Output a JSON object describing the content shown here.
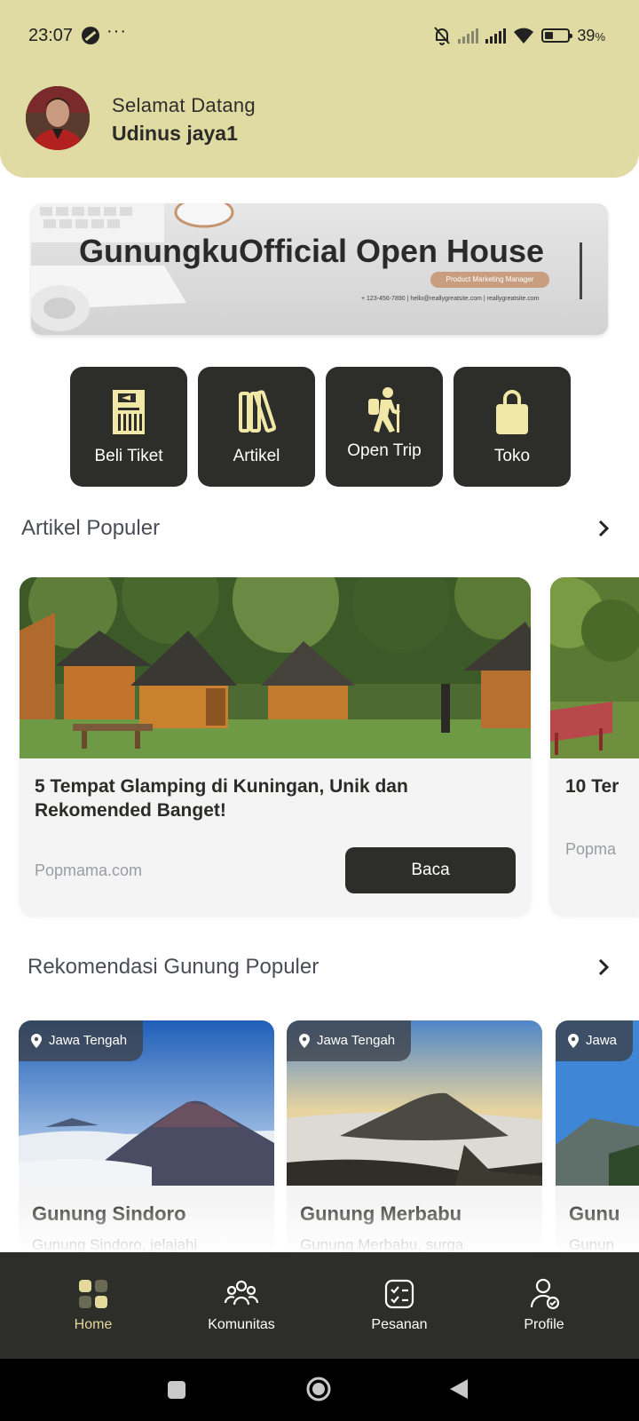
{
  "status_bar": {
    "time": "23:07",
    "dots": "···",
    "battery": "39",
    "battery_unit": "%",
    "battery_level": 0.39
  },
  "header": {
    "greeting": "Selamat Datang",
    "username": "Udinus jaya1"
  },
  "banner": {
    "title": "GunungkuOfficial Open House",
    "pill": "Product Marketing Manager",
    "contact": "+ 123-456-7890  |  hello@reallygreatsite.com  |  reallygreatsite.com"
  },
  "menu": [
    {
      "label": "Beli Tiket",
      "icon": "ticket-icon"
    },
    {
      "label": "Artikel",
      "icon": "books-icon"
    },
    {
      "label": "Open Trip",
      "icon": "hiker-icon"
    },
    {
      "label": "Toko",
      "icon": "shopping-bag-icon"
    }
  ],
  "articles": {
    "title": "Artikel Populer",
    "items": [
      {
        "title": "5 Tempat Glamping di Kuningan, Unik dan Rekomended Banget!",
        "source": "Popmama.com",
        "button": "Baca"
      },
      {
        "title": "10 Ter",
        "source": "Popma"
      }
    ]
  },
  "mountains": {
    "title": "Rekomendasi Gunung Populer",
    "items": [
      {
        "region": "Jawa Tengah",
        "name": "Gunung Sindoro",
        "desc": "Gunung Sindoro, jelajahi"
      },
      {
        "region": "Jawa Tengah",
        "name": "Gunung Merbabu",
        "desc": "Gunung Merbabu, surga"
      },
      {
        "region": "Jawa",
        "name": "Gunu",
        "desc": "Gunun"
      }
    ]
  },
  "bottom_nav": [
    {
      "label": "Home",
      "icon": "grid-icon",
      "active": true
    },
    {
      "label": "Komunitas",
      "icon": "community-icon",
      "active": false
    },
    {
      "label": "Pesanan",
      "icon": "orders-icon",
      "active": false
    },
    {
      "label": "Profile",
      "icon": "profile-icon",
      "active": false
    }
  ],
  "colors": {
    "header_bg": "#e0dba3",
    "dark": "#2d2d29",
    "accent": "#f1e7a6",
    "active_nav": "#e3d99a"
  }
}
